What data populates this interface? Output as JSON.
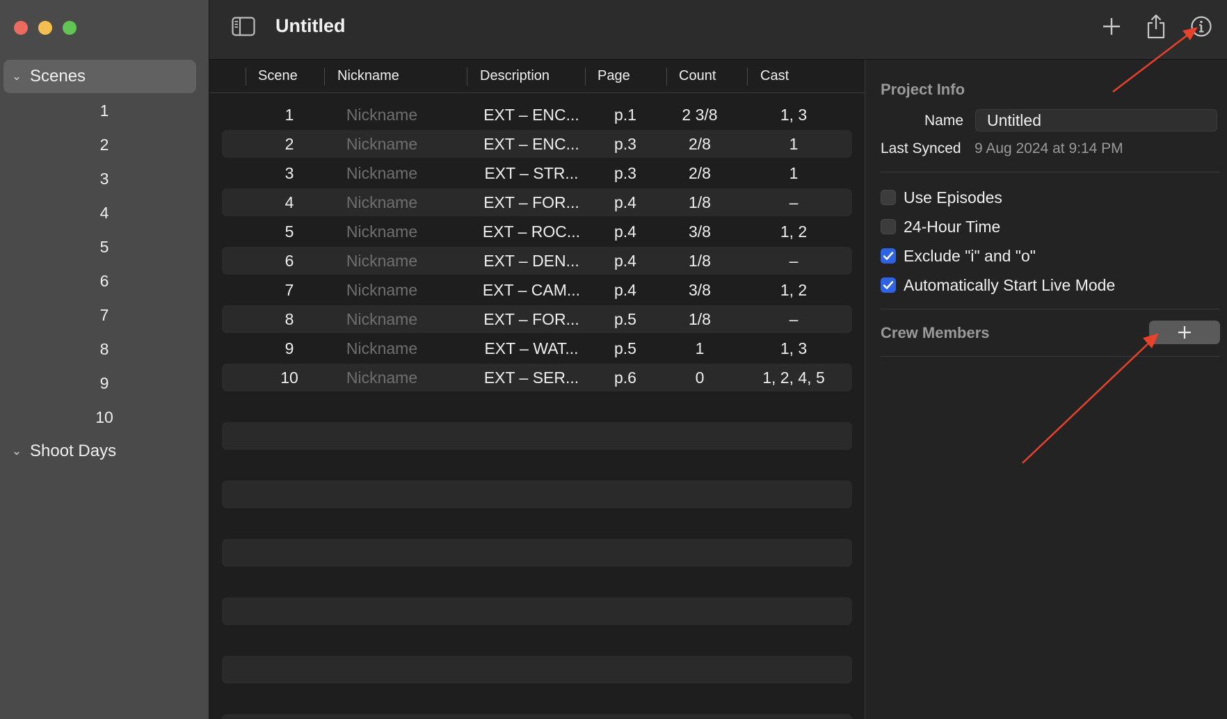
{
  "window": {
    "title": "Untitled"
  },
  "sidebar": {
    "sections": [
      {
        "label": "Scenes",
        "expanded": true,
        "selected": true
      },
      {
        "label": "Shoot Days",
        "expanded": true,
        "selected": false
      }
    ],
    "scene_items": [
      "1",
      "2",
      "3",
      "4",
      "5",
      "6",
      "7",
      "8",
      "9",
      "10"
    ]
  },
  "toolbar": {
    "title": "Untitled",
    "icons": [
      "sidebar-toggle-icon",
      "plus-icon",
      "share-icon",
      "info-icon"
    ]
  },
  "table": {
    "columns": [
      "Scene",
      "Nickname",
      "Description",
      "Page",
      "Count",
      "Cast"
    ],
    "rows": [
      {
        "scene": "1",
        "nickname": "Nickname",
        "description": "EXT – ENC...",
        "page": "p.1",
        "count": "2 3/8",
        "cast": "1, 3"
      },
      {
        "scene": "2",
        "nickname": "Nickname",
        "description": "EXT – ENC...",
        "page": "p.3",
        "count": "2/8",
        "cast": "1"
      },
      {
        "scene": "3",
        "nickname": "Nickname",
        "description": "EXT – STR...",
        "page": "p.3",
        "count": "2/8",
        "cast": "1"
      },
      {
        "scene": "4",
        "nickname": "Nickname",
        "description": "EXT – FOR...",
        "page": "p.4",
        "count": "1/8",
        "cast": "–"
      },
      {
        "scene": "5",
        "nickname": "Nickname",
        "description": "EXT – ROC...",
        "page": "p.4",
        "count": "3/8",
        "cast": "1, 2"
      },
      {
        "scene": "6",
        "nickname": "Nickname",
        "description": "EXT – DEN...",
        "page": "p.4",
        "count": "1/8",
        "cast": "–"
      },
      {
        "scene": "7",
        "nickname": "Nickname",
        "description": "EXT – CAM...",
        "page": "p.4",
        "count": "3/8",
        "cast": "1, 2"
      },
      {
        "scene": "8",
        "nickname": "Nickname",
        "description": "EXT – FOR...",
        "page": "p.5",
        "count": "1/8",
        "cast": "–"
      },
      {
        "scene": "9",
        "nickname": "Nickname",
        "description": "EXT – WAT...",
        "page": "p.5",
        "count": "1",
        "cast": "1, 3"
      },
      {
        "scene": "10",
        "nickname": "Nickname",
        "description": "EXT – SER...",
        "page": "p.6",
        "count": "0",
        "cast": "1, 2, 4, 5"
      }
    ]
  },
  "inspector": {
    "project_info": {
      "heading": "Project Info",
      "name_label": "Name",
      "name_value": "Untitled",
      "last_synced_label": "Last Synced",
      "last_synced_value": "9 Aug 2024 at 9:14 PM"
    },
    "options": [
      {
        "label": "Use Episodes",
        "checked": false
      },
      {
        "label": "24-Hour Time",
        "checked": false
      },
      {
        "label": "Exclude \"i\" and \"o\"",
        "checked": true
      },
      {
        "label": "Automatically Start Live Mode",
        "checked": true
      }
    ],
    "crew": {
      "heading": "Crew Members"
    }
  },
  "colors": {
    "sidebar_bg": "#4a4a4a",
    "selection_bg": "#616161",
    "checkbox_on": "#2e63e6",
    "annotation_arrow": "#e8412c"
  }
}
